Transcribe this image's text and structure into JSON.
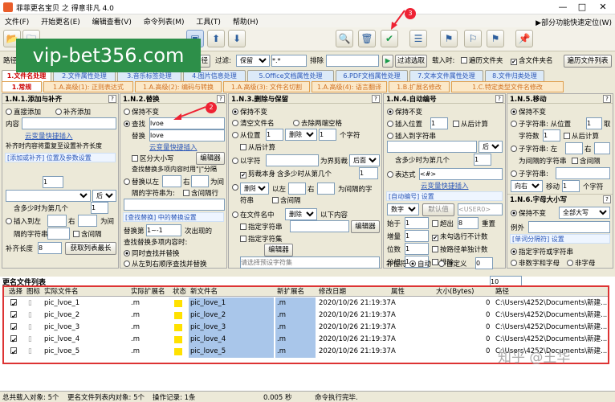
{
  "window": {
    "title": "菲菲更名宝贝 之 得意非凡 4.0"
  },
  "menu": [
    "文件(F)",
    "开始更名(E)",
    "编辑查看(V)",
    "命令列表(M)",
    "工具(T)",
    "帮助(H)"
  ],
  "right_link": "▶部分功能快速定位(W)",
  "path_bar": {
    "path_label": "路径",
    "path_value": "C:\\Users\\4252\\Documents\\新建文件",
    "load_path_btn": "载入路径",
    "filter_label": "过滤:",
    "filter_mode": "保留",
    "filter_value": "*.*",
    "exclude_label": "排除",
    "filter_select_btn": "过滤选取",
    "load_time_label": "载入时:",
    "opt_folder": "遍历文件夹",
    "opt_include_folder_name": "含文件夹名",
    "browse_list_btn": "遍历文件列表"
  },
  "tabs_main": [
    "1.文件名处理",
    "2.文件属性处理",
    "3.音乐标签处理",
    "4.图片信息处理",
    "5.Office文档属性处理",
    "6.PDF文档属性处理",
    "7.文本文件属性处理",
    "8.文件归类处理"
  ],
  "tabs_sub": [
    "1.常规",
    "1.A.高级(1): 正则表达式",
    "1.A.高级(2): 编码与转换",
    "1.A.高级(3): 文件名切割",
    "1.A.高级(4): 语言翻译",
    "1.B.扩展名修改",
    "1.C.特定类型文件名修改"
  ],
  "panel_add": {
    "title": "1.N.1.添加与补齐",
    "opt_direct_add": "直接添加",
    "opt_pad_add": "补齐添加",
    "content_label": "内容",
    "quick_insert": "云变量快捷插入",
    "pad_note": "补齐时内容将重复至设置补齐长度",
    "position_header": "[添加或补齐] 位置及参数设置",
    "spin1_value": "1",
    "after_label": "后",
    "how_many_label": "含多少时为第几个",
    "spin2_value": "1",
    "insert_to_label": "插入到左",
    "right_label": "右",
    "as_label": "为间",
    "interval_label": "隔的字符串",
    "include_interval": "含间隔",
    "pad_len_label": "补齐长度",
    "pad_len_value": "8",
    "get_list_len_btn": "获取列表最长"
  },
  "panel_replace": {
    "title": "1.N.2.替换",
    "opt_keep": "保持不变",
    "opt_find": "查找",
    "find_value": "lvoe",
    "replace_label": "替换",
    "replace_value": "love",
    "quick_insert": "云变量快捷插入",
    "case_sensitive": "区分大小写",
    "editor_btn": "编辑器",
    "multi_note": "查找替换多项内容时用\"|\"分隔",
    "opt_replace_between": "替换以左",
    "right_label": "右",
    "as_label": "为间",
    "interval_label": "隔的字符串为:",
    "include_interval": "含间隔行",
    "section2": "[查找替换] 中的替换设置",
    "replace_nth_label": "替换第",
    "replace_nth_value": "1~-1",
    "times_label": "次出现的",
    "multi_label": "查找替换多项内容时:",
    "opt_simultaneous": "同时查找并替换",
    "opt_left_to_right": "从左到右顺序查找并替换"
  },
  "panel_delete": {
    "title": "1.N.3.删除与保留",
    "opt_keep": "保持不变",
    "opt_clear_file": "清空文件名",
    "opt_remove_spaces": "去除两端空格",
    "opt_from_pos": "从位置",
    "spin1": "1",
    "delete_label": "删除",
    "spin2": "1",
    "chars_label": "个字符",
    "from_right": "从后计算",
    "opt_char": "以字符",
    "as_bound": "为界剪裁",
    "after": "后面",
    "cut_self": "剪裁本身",
    "contains_label": "含多少时从第几个",
    "spin3": "1",
    "opt_delete": "删除",
    "by_left": "以左",
    "right": "右",
    "as_interval": "为间隔的字",
    "string_label": "符串",
    "include_interval": "含间隔",
    "opt_in_filename": "在文件名中",
    "delete_mode": "删除",
    "below_content": "以下内容",
    "specify_string": "指定字符串",
    "editor_btn": "编辑器",
    "specify_charset": "指定字符集",
    "editor_btn2": "编辑器",
    "preset_placeholder": "请选择预设字符集"
  },
  "panel_number": {
    "title": "1.N.4.自动编号",
    "opt_keep": "保持不变",
    "opt_insert_pos": "插入位置",
    "pos_value": "1",
    "from_right": "从后计算",
    "opt_insert_char": "插入到字符串",
    "after": "后",
    "contains_label": "含多少时为第几个",
    "spin1": "1",
    "opt_expression": "表达式",
    "expr_value": "<#>",
    "quick_insert": "云变量快捷插入",
    "auto_settings": "[自动编号] 设置",
    "number_type": "数字",
    "default_value": "默认值",
    "user0": "<USER0>",
    "start_label": "始于",
    "start_value": "1",
    "overflow": "超出",
    "overflow_value": "8",
    "reset": "重置",
    "step_label": "增量",
    "step_value": "1",
    "no_select_count": "未勾选行不计数",
    "digits_label": "位数",
    "digits_value": "1",
    "by_path_count": "按路径单独计数",
    "group_label": "分组",
    "group_value": "1",
    "arrange": "排除",
    "pad_label": "补位符",
    "opt_auto": "自动",
    "opt_custom": "自定义",
    "custom_value": "0"
  },
  "panel_move": {
    "title": "1.N.5.移动",
    "opt_keep": "保持不变",
    "opt_substring_from": "子字符串: 从位置",
    "pos1": "1",
    "take_label": "取",
    "chars_label": "字符数",
    "chars_value": "1",
    "from_right": "从后计算",
    "opt_substring2": "子字符串: 左",
    "right": "右",
    "as_interval": "为间隔的字符串",
    "include_interval": "含间隔",
    "opt_substring3": "子字符串:",
    "direction": "向右",
    "move_label": "移动",
    "move_value": "1",
    "chars_suffix": "个字符",
    "case_title": "1.N.6.字母大小写",
    "case_keep": "保持不变",
    "case_mode": "全部大写",
    "example_label": "例外",
    "word_sep_title": "[单词分隔符] 设置",
    "opt_by_char": "指定字符或字符串",
    "opt_non_alnum": "非数字和字母",
    "opt_non_space": "非字母"
  },
  "list": {
    "title": "更名文件列表",
    "count_box": "10",
    "headers": [
      "选择",
      "图标",
      "实际文件名",
      "实际扩展名",
      "状态",
      "新文件名",
      "新扩展名",
      "修改日期",
      "属性",
      "大小(Bytes)",
      "路径"
    ],
    "rows": [
      {
        "old": "pic_lvoe_1",
        "ext": ".m",
        "new": "pic_love_1",
        "newext": ".m",
        "date": "2020/10/26 21:19:37",
        "attr": "A",
        "size": "0",
        "path": "C:\\Users\\4252\\Documents\\新建..."
      },
      {
        "old": "pic_lvoe_2",
        "ext": ".m",
        "new": "pic_love_2",
        "newext": ".m",
        "date": "2020/10/26 21:19:37",
        "attr": "A",
        "size": "0",
        "path": "C:\\Users\\4252\\Documents\\新建..."
      },
      {
        "old": "pic_lvoe_3",
        "ext": ".m",
        "new": "pic_love_3",
        "newext": ".m",
        "date": "2020/10/26 21:19:37",
        "attr": "A",
        "size": "0",
        "path": "C:\\Users\\4252\\Documents\\新建..."
      },
      {
        "old": "pic_lvoe_4",
        "ext": ".m",
        "new": "pic_love_4",
        "newext": ".m",
        "date": "2020/10/26 21:19:37",
        "attr": "A",
        "size": "0",
        "path": "C:\\Users\\4252\\Documents\\新建..."
      },
      {
        "old": "pic_lvoe_5",
        "ext": ".m",
        "new": "pic_love_5",
        "newext": ".m",
        "date": "2020/10/26 21:19:37",
        "attr": "A",
        "size": "0",
        "path": "C:\\Users\\4252\\Documents\\新建..."
      }
    ]
  },
  "status": {
    "loaded": "总共载入对象: 5个",
    "in_list": "更名文件列表内对象: 5个",
    "ops": "操作记录: 1条",
    "time": "0.005 秒",
    "msg": "命令执行完毕."
  },
  "overlays": {
    "watermark": "vip-bet356.com",
    "zhihu": "知乎 @王华",
    "badge2": "2",
    "badge3": "3"
  },
  "colors": {
    "accent": "#2b57b8",
    "highlight": "#a9c6ea",
    "red": "#d33"
  }
}
